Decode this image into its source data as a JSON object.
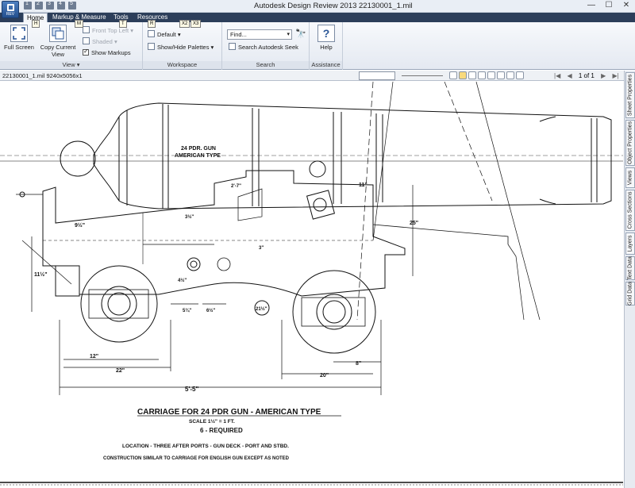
{
  "window": {
    "title": "Autodesk Design Review 2013    22130001_1.mil",
    "app_button_label": "REV",
    "minimize": "—",
    "maximize": "☐",
    "close": "✕"
  },
  "quick_access_keytips": [
    "1",
    "2",
    "3",
    "4",
    "5"
  ],
  "tabs": [
    {
      "label": "Home",
      "keytip": "H"
    },
    {
      "label": "Markup & Measure",
      "keytip": "M"
    },
    {
      "label": "Tools",
      "keytip": "T"
    },
    {
      "label": "Resources",
      "keytip": "R"
    }
  ],
  "tab_keytips_extra": [
    "X2",
    "X3"
  ],
  "ribbon": {
    "view": {
      "label": "View",
      "full_screen": "Full Screen",
      "copy_current_view": "Copy Current View",
      "front_top_left": "Front Top Left",
      "shaded": "Shaded",
      "show_markups": "Show Markups"
    },
    "workspace": {
      "label": "Workspace",
      "default": "Default",
      "show_hide_palettes": "Show/Hide Palettes"
    },
    "search": {
      "label": "Search",
      "find_placeholder": "Find...",
      "search_seek": "Search Autodesk Seek"
    },
    "assistance": {
      "label": "Assistance",
      "help": "Help"
    }
  },
  "toolbar": {
    "file_info": "22130001_1.mil 9240x5056x1",
    "page_indicator": "1 of 1"
  },
  "side_palettes": [
    "Sheet Properties",
    "Object Properties",
    "Views",
    "Cross Sections",
    "Layers",
    "Text Data",
    "Grid Data"
  ],
  "drawing": {
    "title": "CARRIAGE FOR 24 PDR GUN - AMERICAN TYPE",
    "scale": "SCALE 1½\" = 1 FT.",
    "required": "6 - REQUIRED",
    "location": "LOCATION - THREE AFTER PORTS - GUN DECK - PORT AND STBD.",
    "construction": "CONSTRUCTION SIMILAR TO CARRIAGE FOR ENGLISH GUN EXCEPT AS NOTED",
    "gun_label_1": "24 PDR. GUN",
    "gun_label_2": "AMERICAN TYPE",
    "dims": {
      "d_9_5": "9½\"",
      "d_11_5": "11½\"",
      "d_12": "12\"",
      "d_22": "22\"",
      "d_5_5": "5'-5\"",
      "d_20": "20\"",
      "d_8": "8\"",
      "d_25": "25\"",
      "d_2_7": "2'-7\"",
      "d_11": "11\"",
      "d_3_5": "3½\"",
      "d_4_5": "4½\"",
      "d_5_3": "5¾\"",
      "d_6_5": "6½\"",
      "d_21_5": "21½\"",
      "d_3": "3\""
    }
  }
}
